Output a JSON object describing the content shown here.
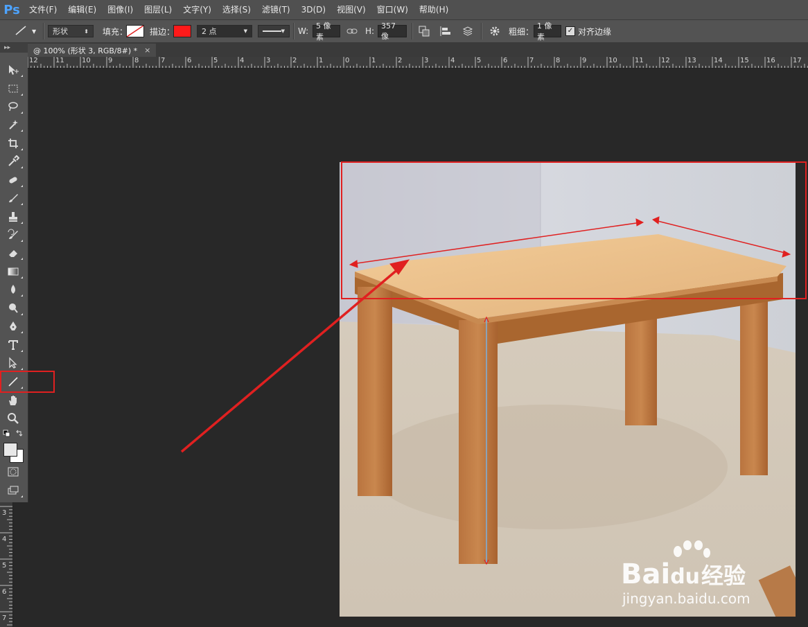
{
  "app": {
    "logo": "Ps"
  },
  "menu": [
    "文件(F)",
    "编辑(E)",
    "图像(I)",
    "图层(L)",
    "文字(Y)",
    "选择(S)",
    "滤镜(T)",
    "3D(D)",
    "视图(V)",
    "窗口(W)",
    "帮助(H)"
  ],
  "options": {
    "tool_mode": "形状",
    "fill_label": "填充：",
    "stroke_label": "描边：",
    "stroke_color": "#ff1a1a",
    "stroke_width": "2 点",
    "w_label": "W:",
    "w_value": "5 像素",
    "h_label": "H:",
    "h_value": "357 像",
    "weight_label": "粗细：",
    "weight_value": "1 像素",
    "align_edges_label": "对齐边缘",
    "align_edges_checked": true
  },
  "document": {
    "tab_title": "@ 100% (形状 3, RGB/8#) *",
    "close": "×"
  },
  "ruler_h": [
    "12",
    "11",
    "10",
    "9",
    "8",
    "7",
    "6",
    "5",
    "4",
    "3",
    "2",
    "1",
    "0",
    "1",
    "2",
    "3",
    "4",
    "5",
    "6",
    "7",
    "8",
    "9",
    "10",
    "11",
    "12",
    "13",
    "14",
    "15",
    "16",
    "17"
  ],
  "ruler_v": [
    "3",
    "4",
    "5",
    "6",
    "7"
  ],
  "toolbar": {
    "collapse": "▸▸"
  },
  "watermark": {
    "brand": "Bai",
    "brand2": "du",
    "cn": "经验",
    "url": "jingyan.baidu.com"
  },
  "colors": {
    "highlight": "#e02020",
    "accent": "#4da3ff"
  }
}
